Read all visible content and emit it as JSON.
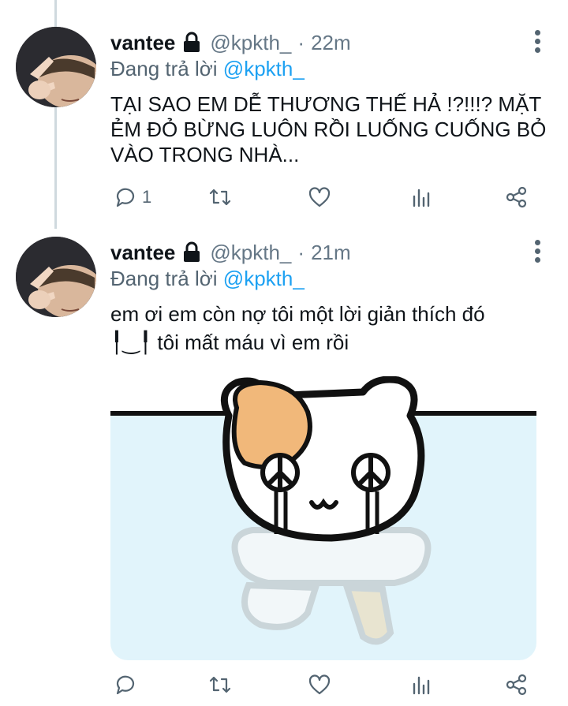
{
  "tweets": [
    {
      "name": "vantee",
      "handle": "@kpkth_",
      "separator": "·",
      "time": "22m",
      "replying_prefix": "Đang trả lời",
      "replying_to": "@kpkth_",
      "text": "TẠI SAO EM DỄ THƯƠNG THẾ HẢ !?!!!? MẶT ẺM ĐỎ BỪNG LUÔN RỒI LUỐNG CUỐNG BỎ VÀO TRONG NHÀ...",
      "reply_count": "1"
    },
    {
      "name": "vantee",
      "handle": "@kpkth_",
      "separator": "·",
      "time": "21m",
      "replying_prefix": "Đang trả lời",
      "replying_to": "@kpkth_",
      "text": "em ơi em còn nợ tôi một lời giản thích đó ╿‿╿ tôi mất máu vì em rồi",
      "reply_count": ""
    }
  ],
  "colors": {
    "link": "#1da1f2",
    "secondary": "#536471",
    "thread_line": "#cfd9de"
  },
  "icons": [
    "lock-icon",
    "more-icon",
    "reply-icon",
    "retweet-icon",
    "like-icon",
    "analytics-icon",
    "share-icon"
  ]
}
